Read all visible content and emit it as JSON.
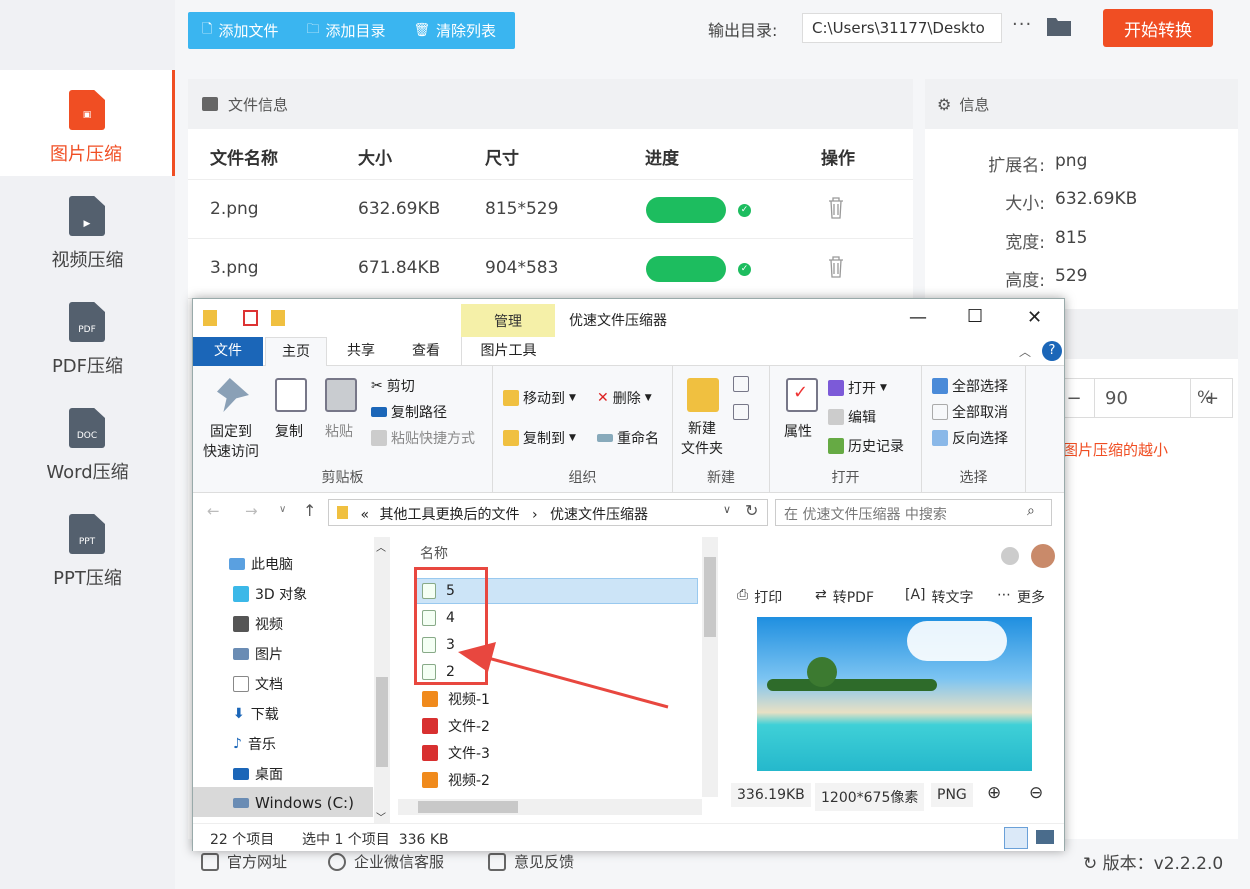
{
  "sidebar": {
    "items": [
      {
        "label": "图片压缩",
        "icon": "image-file-icon",
        "badge": ""
      },
      {
        "label": "视频压缩",
        "icon": "video-file-icon",
        "badge": ""
      },
      {
        "label": "PDF压缩",
        "icon": "pdf-file-icon",
        "badge": "PDF"
      },
      {
        "label": "Word压缩",
        "icon": "doc-file-icon",
        "badge": "DOC"
      },
      {
        "label": "PPT压缩",
        "icon": "ppt-file-icon",
        "badge": "PPT"
      }
    ]
  },
  "toolbar": {
    "add_file": "添加文件",
    "add_dir": "添加目录",
    "clear_list": "清除列表",
    "output_label": "输出目录:",
    "output_path": "C:\\Users\\31177\\Deskto",
    "more": "···",
    "start": "开始转换"
  },
  "file_panel": {
    "title": "文件信息",
    "columns": [
      "文件名称",
      "大小",
      "尺寸",
      "进度",
      "操作"
    ],
    "rows": [
      {
        "name": "2.png",
        "size": "632.69KB",
        "dims": "815*529",
        "progress": 1.0
      },
      {
        "name": "3.png",
        "size": "671.84KB",
        "dims": "904*583",
        "progress": 1.0
      }
    ]
  },
  "info_panel": {
    "title": "信息",
    "ext_label": "扩展名:",
    "ext": "png",
    "size_label": "大小:",
    "size": "632.69KB",
    "width_label": "宽度:",
    "width": "815",
    "height_label": "高度:",
    "height": "529"
  },
  "quality": {
    "minus": "−",
    "value": "90",
    "plus": "+",
    "unit": "%",
    "note": "图片压缩的越小"
  },
  "footer": {
    "website": "官方网址",
    "wechat": "企业微信客服",
    "feedback": "意见反馈",
    "version": "版本：v2.2.2.0"
  },
  "explorer": {
    "manage_tab": "管理",
    "title": "优速文件压缩器",
    "tabs": {
      "file": "文件",
      "home": "主页",
      "share": "共享",
      "view": "查看",
      "picture_tools": "图片工具"
    },
    "ribbon": {
      "pin": "固定到",
      "pin2": "快速访问",
      "copy": "复制",
      "paste": "粘贴",
      "cut": "剪切",
      "copy_path": "复制路径",
      "paste_shortcut": "粘贴快捷方式",
      "clipboard": "剪贴板",
      "move_to": "移动到",
      "copy_to": "复制到",
      "delete": "删除",
      "rename": "重命名",
      "organize": "组织",
      "new_folder": "新建",
      "new_folder2": "文件夹",
      "new": "新建",
      "properties": "属性",
      "open": "打开",
      "edit": "编辑",
      "history": "历史记录",
      "open_group": "打开",
      "select_all": "全部选择",
      "select_none": "全部取消",
      "invert": "反向选择",
      "select_group": "选择"
    },
    "address": {
      "prefix": "«",
      "crumb1": "其他工具更换后的文件",
      "crumb2": "优速文件压缩器",
      "search_placeholder": "在 优速文件压缩器 中搜索"
    },
    "nav": [
      "此电脑",
      "3D 对象",
      "视频",
      "图片",
      "文档",
      "下载",
      "音乐",
      "桌面",
      "Windows (C:)"
    ],
    "files_header": "名称",
    "files": [
      "5",
      "4",
      "3",
      "2",
      "视频-1",
      "文件-2",
      "文件-3",
      "视频-2"
    ],
    "preview": {
      "print": "打印",
      "to_pdf": "转PDF",
      "to_text": "转文字",
      "more": "更多",
      "size": "336.19KB",
      "dims": "1200*675像素",
      "format": "PNG"
    },
    "status": {
      "count": "22 个项目",
      "selected": "选中 1 个项目  336 KB"
    }
  },
  "colors": {
    "accent": "#f04e23",
    "blue": "#3ab5f0",
    "green": "#1dbd5f",
    "highlight": "#e8473f"
  }
}
